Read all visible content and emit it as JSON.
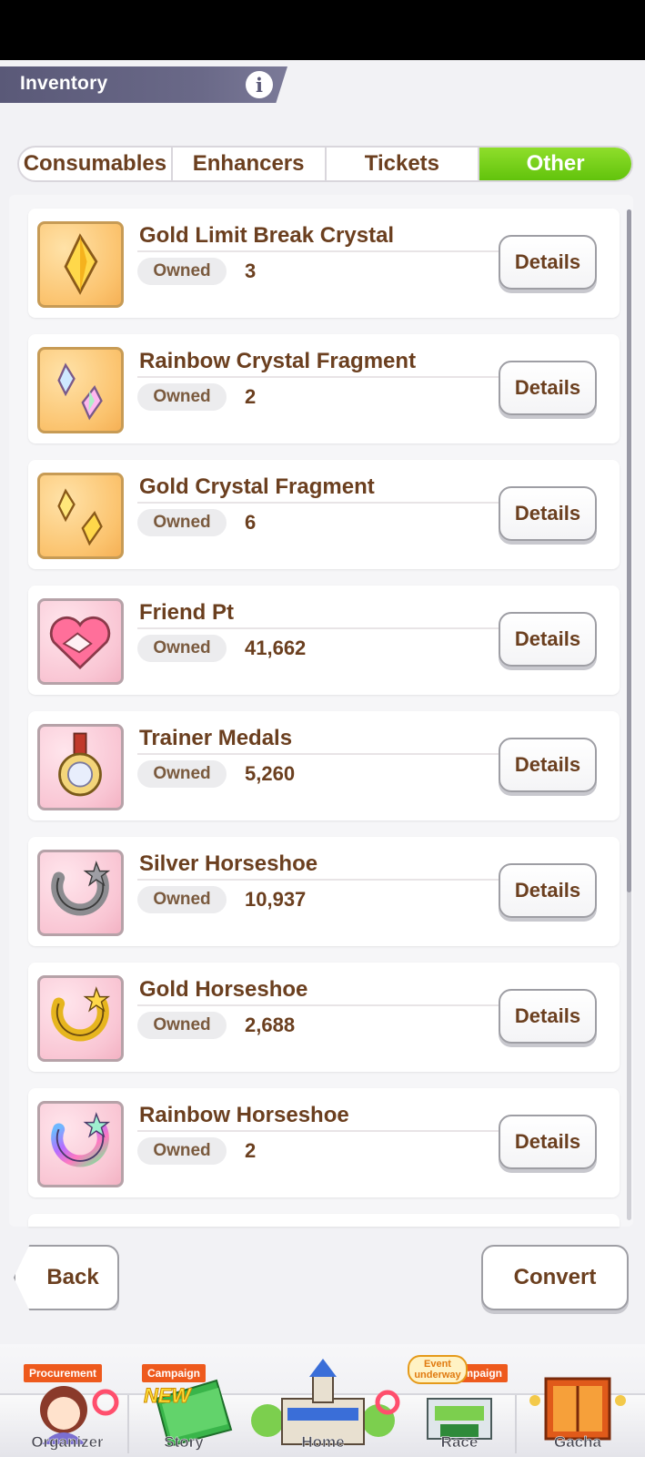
{
  "header": {
    "title": "Inventory"
  },
  "tabs": [
    {
      "label": "Consumables",
      "active": false
    },
    {
      "label": "Enhancers",
      "active": false
    },
    {
      "label": "Tickets",
      "active": false
    },
    {
      "label": "Other",
      "active": true
    }
  ],
  "items": [
    {
      "name": "Gold Limit Break Crystal",
      "owned_label": "Owned",
      "count": "3",
      "button": "Details",
      "icon": "gold-crystal-icon",
      "bg": "gold"
    },
    {
      "name": "Rainbow Crystal Fragment",
      "owned_label": "Owned",
      "count": "2",
      "button": "Details",
      "icon": "rainbow-fragment-icon",
      "bg": "gold"
    },
    {
      "name": "Gold Crystal Fragment",
      "owned_label": "Owned",
      "count": "6",
      "button": "Details",
      "icon": "gold-fragment-icon",
      "bg": "gold"
    },
    {
      "name": "Friend Pt",
      "owned_label": "Owned",
      "count": "41,662",
      "button": "Details",
      "icon": "handshake-icon",
      "bg": "pink"
    },
    {
      "name": "Trainer Medals",
      "owned_label": "Owned",
      "count": "5,260",
      "button": "Details",
      "icon": "medal-icon",
      "bg": "pink"
    },
    {
      "name": "Silver Horseshoe",
      "owned_label": "Owned",
      "count": "10,937",
      "button": "Details",
      "icon": "silver-horseshoe-icon",
      "bg": "pink"
    },
    {
      "name": "Gold Horseshoe",
      "owned_label": "Owned",
      "count": "2,688",
      "button": "Details",
      "icon": "gold-horseshoe-icon",
      "bg": "pink"
    },
    {
      "name": "Rainbow Horseshoe",
      "owned_label": "Owned",
      "count": "2",
      "button": "Details",
      "icon": "rainbow-horseshoe-icon",
      "bg": "pink"
    }
  ],
  "footer": {
    "back_label": "Back",
    "convert_label": "Convert"
  },
  "nav": [
    {
      "label": "Organizer",
      "badge": "Procurement",
      "icon": "organizer-icon"
    },
    {
      "label": "Story",
      "badge": "Campaign",
      "icon": "story-icon",
      "extra": "NEW"
    },
    {
      "label": "Home",
      "badge": "",
      "icon": "home-icon"
    },
    {
      "label": "Race",
      "badge": "Campaign",
      "icon": "race-icon",
      "extra": "Event underway"
    },
    {
      "label": "Gacha",
      "badge": "",
      "icon": "gacha-icon"
    }
  ],
  "colors": {
    "accent_green": "#62c30c",
    "brown_text": "#6b3f1f",
    "badge_orange": "#ee5a1d",
    "title_bar": "#5a5978"
  }
}
